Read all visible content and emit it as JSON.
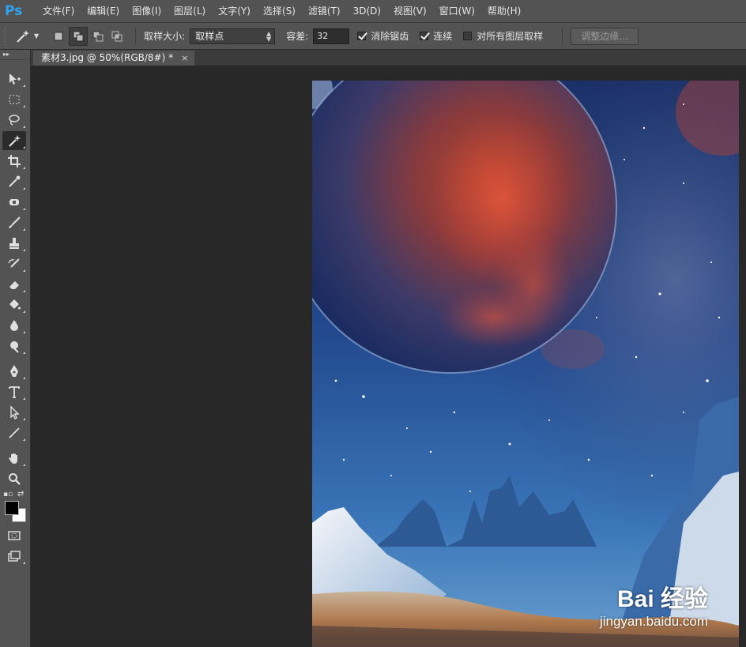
{
  "app": {
    "logo": "Ps"
  },
  "menubar": {
    "items": [
      "文件(F)",
      "编辑(E)",
      "图像(I)",
      "图层(L)",
      "文字(Y)",
      "选择(S)",
      "滤镜(T)",
      "3D(D)",
      "视图(V)",
      "窗口(W)",
      "帮助(H)"
    ]
  },
  "options": {
    "tool_icon": "magic-wand-icon",
    "sample_size_label": "取样大小:",
    "sample_size_value": "取样点",
    "tolerance_label": "容差:",
    "tolerance_value": "32",
    "anti_alias_label": "消除锯齿",
    "anti_alias_checked": true,
    "contiguous_label": "连续",
    "contiguous_checked": true,
    "sample_all_layers_label": "对所有图层取样",
    "sample_all_layers_checked": false,
    "refine_edge_label": "调整边缘..."
  },
  "document": {
    "tab_title": "素材3.jpg @ 50%(RGB/8#) *",
    "close_glyph": "×"
  },
  "watermark": {
    "brand": "Bai 经验",
    "url": "jingyan.baidu.com"
  },
  "colors": {
    "foreground": "#000000",
    "background": "#ffffff",
    "accent": "#2fa3f0"
  }
}
